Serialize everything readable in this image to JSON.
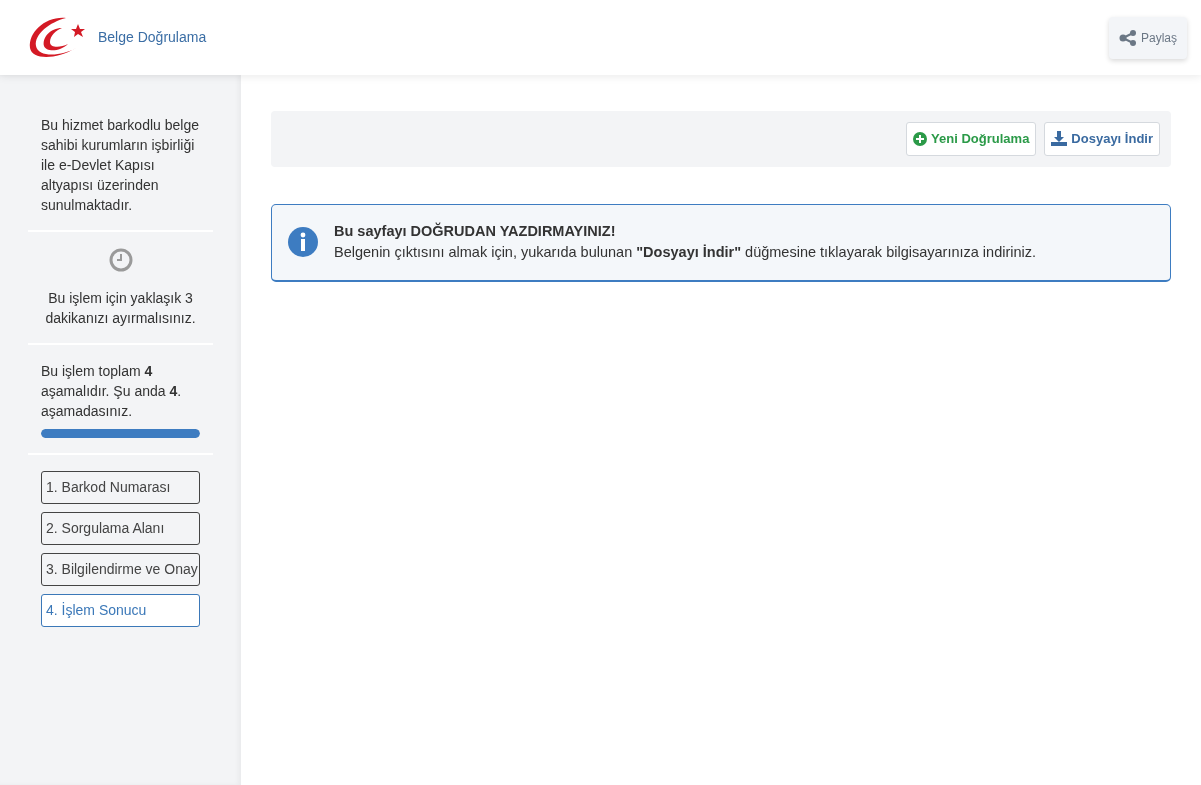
{
  "header": {
    "title": "Belge Doğrulama",
    "share_button": "Paylaş"
  },
  "sidebar": {
    "info": "Bu hizmet barkodlu belge sahibi kurumların işbirliği ile e-Devlet Kapısı altyapısı üzerinden sunulmaktadır.",
    "time_note": "Bu işlem için yaklaşık 3 dakikanızı ayırmalısınız.",
    "progress_text": "Bu işlem toplam **4** aşamalıdır. Şu anda **4**. aşamadasınız.",
    "progress": {
      "level": 1.0
    },
    "steps": [
      {
        "label": "1. Barkod Numarası",
        "selected": false
      },
      {
        "label": "2. Sorgulama Alanı",
        "selected": false
      },
      {
        "label": "3. Bilgilendirme ve Onay",
        "selected": false
      },
      {
        "label": "4. İşlem Sonucu",
        "selected": true
      }
    ]
  },
  "toolbar": {
    "buttons": [
      {
        "label": "Yeni Doğrulama",
        "kind": "new"
      },
      {
        "label": "Dosyayı İndir",
        "kind": "download"
      }
    ]
  },
  "alert": {
    "title": "Bu sayfayı DOĞRUDAN YAZDIRMAYINIZ!",
    "message": "Belgenin çıktısını almak için, yukarıda bulunan **\"Dosyayı İndir\"** düğmesine tıklayarak bilgisayarınıza indiriniz."
  }
}
